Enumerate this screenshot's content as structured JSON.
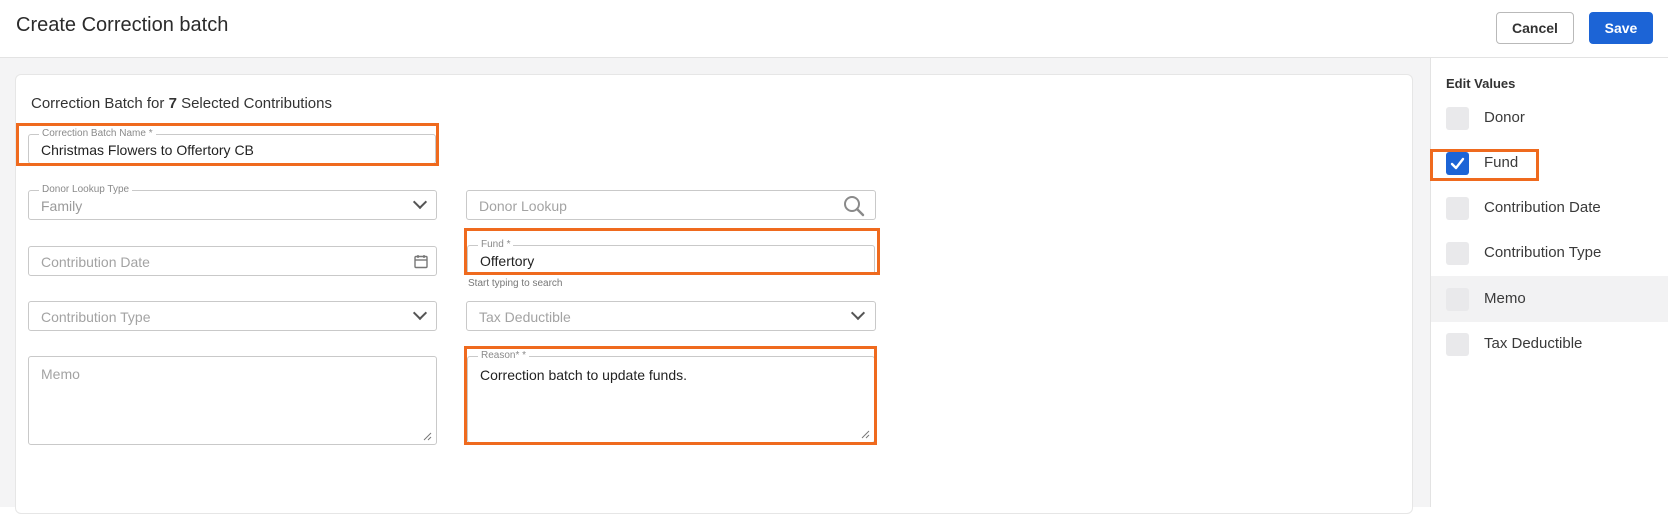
{
  "header": {
    "title": "Create Correction batch",
    "cancel_label": "Cancel",
    "save_label": "Save"
  },
  "form": {
    "heading_prefix": "Correction Batch for ",
    "selected_count": "7",
    "heading_suffix": " Selected Contributions",
    "batch_name": {
      "label": "Correction Batch Name *",
      "value": "Christmas Flowers to Offertory CB"
    },
    "donor_lookup_type": {
      "label": "Donor Lookup Type",
      "value": "Family"
    },
    "donor_lookup": {
      "placeholder": "Donor Lookup"
    },
    "contribution_date": {
      "placeholder": "Contribution Date"
    },
    "fund": {
      "label": "Fund *",
      "value": "Offertory",
      "hint": "Start typing to search"
    },
    "contribution_type": {
      "placeholder": "Contribution Type"
    },
    "tax_deductible": {
      "placeholder": "Tax Deductible"
    },
    "memo": {
      "placeholder": "Memo"
    },
    "reason": {
      "label": "Reason* *",
      "value": "Correction batch to update funds."
    }
  },
  "edit_values": {
    "title": "Edit Values",
    "options": [
      {
        "label": "Donor",
        "checked": false
      },
      {
        "label": "Fund",
        "checked": true
      },
      {
        "label": "Contribution Date",
        "checked": false
      },
      {
        "label": "Contribution Type",
        "checked": false
      },
      {
        "label": "Memo",
        "checked": false
      },
      {
        "label": "Tax Deductible",
        "checked": false
      }
    ]
  },
  "colors": {
    "accent": "#1c64d6",
    "highlight": "#ef6a1e"
  },
  "icons": [
    "search-icon",
    "calendar-icon",
    "chevron-down-icon",
    "checkmark-icon",
    "resize-handle-icon"
  ]
}
